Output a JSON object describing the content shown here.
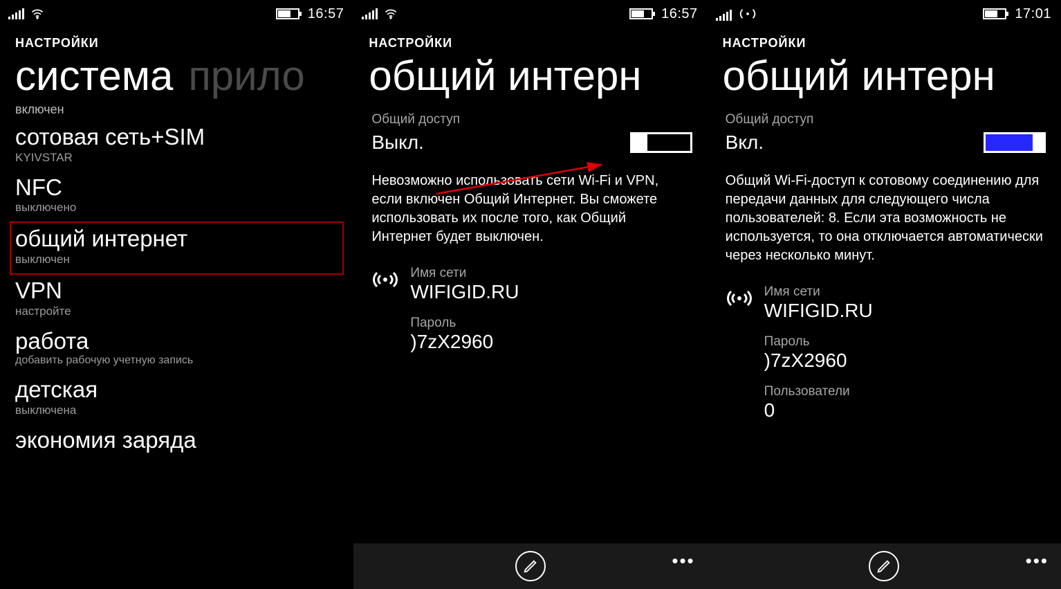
{
  "screen1": {
    "status": {
      "time": "16:57"
    },
    "overline": "НАСТРОЙКИ",
    "title_primary": "система",
    "title_secondary": "прило",
    "bluetooth_status_cut": "включен",
    "items": [
      {
        "title": "сотовая сеть+SIM",
        "sub": "KYIVSTAR"
      },
      {
        "title": "NFC",
        "sub": "выключено"
      },
      {
        "title": "общий интернет",
        "sub": "выключен"
      },
      {
        "title": "VPN",
        "sub": "настройте"
      },
      {
        "title": "работа",
        "sub": "добавить рабочую учетную запись"
      },
      {
        "title": "детская",
        "sub": "выключена"
      },
      {
        "title": "экономия заряда",
        "sub": ""
      }
    ]
  },
  "screen2": {
    "status": {
      "time": "16:57"
    },
    "overline": "НАСТРОЙКИ",
    "title": "общий интерн",
    "share_label": "Общий доступ",
    "share_state": "Выкл.",
    "description": "Невозможно использовать сети Wi-Fi и VPN, если включен Общий Интернет. Вы сможете использовать их после того, как Общий Интернет будет выключен.",
    "net_label": "Имя сети",
    "net_value": "WIFIGID.RU",
    "pwd_label": "Пароль",
    "pwd_value": ")7zX2960"
  },
  "screen3": {
    "status": {
      "time": "17:01"
    },
    "overline": "НАСТРОЙКИ",
    "title": "общий интерн",
    "share_label": "Общий доступ",
    "share_state": "Вкл.",
    "description": "Общий Wi-Fi-доступ к сотовому соединению для передачи данных для следующего числа пользователей: 8. Если эта возможность не используется, то она отключается автоматически через несколько минут.",
    "net_label": "Имя сети",
    "net_value": "WIFIGID.RU",
    "pwd_label": "Пароль",
    "pwd_value": ")7zX2960",
    "users_label": "Пользователи",
    "users_value": "0"
  },
  "icons": {
    "edit": "edit",
    "broadcast": "broadcast"
  }
}
